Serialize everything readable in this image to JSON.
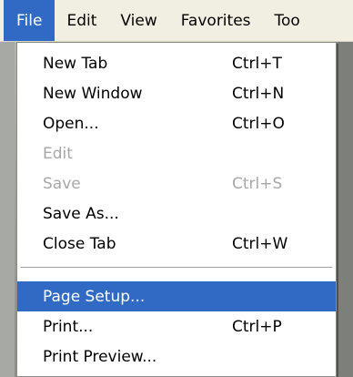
{
  "menubar": {
    "items": [
      {
        "label": "File",
        "active": true
      },
      {
        "label": "Edit"
      },
      {
        "label": "View"
      },
      {
        "label": "Favorites"
      },
      {
        "label": "Too"
      }
    ]
  },
  "file_menu": {
    "items": [
      {
        "label": "New Tab",
        "shortcut": "Ctrl+T",
        "enabled": true
      },
      {
        "label": "New Window",
        "shortcut": "Ctrl+N",
        "enabled": true
      },
      {
        "label": "Open...",
        "shortcut": "Ctrl+O",
        "enabled": true
      },
      {
        "label": "Edit",
        "shortcut": "",
        "enabled": false
      },
      {
        "label": "Save",
        "shortcut": "Ctrl+S",
        "enabled": false
      },
      {
        "label": "Save As...",
        "shortcut": "",
        "enabled": true
      },
      {
        "label": "Close Tab",
        "shortcut": "Ctrl+W",
        "enabled": true
      },
      {
        "label": "Page Setup...",
        "shortcut": "",
        "enabled": true,
        "highlighted": true
      },
      {
        "label": "Print...",
        "shortcut": "Ctrl+P",
        "enabled": true
      },
      {
        "label": "Print Preview...",
        "shortcut": "",
        "enabled": true
      }
    ]
  },
  "colors": {
    "highlight": "#316ac5",
    "menubar_bg": "#f1efe2",
    "disabled_text": "#a7a7a7"
  }
}
